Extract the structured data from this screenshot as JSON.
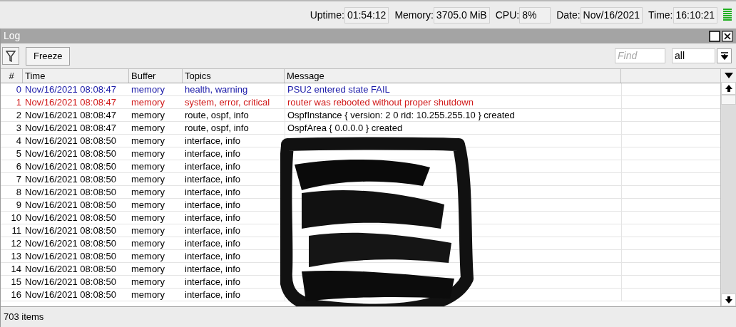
{
  "status": [
    {
      "label": "Uptime:",
      "value": "01:54:12"
    },
    {
      "label": "Memory:",
      "value": "3705.0 MiB"
    },
    {
      "label": "CPU:",
      "value": "8%"
    },
    {
      "label": "Date:",
      "value": "Nov/16/2021"
    },
    {
      "label": "Time:",
      "value": "16:10:21"
    }
  ],
  "window": {
    "title": "Log"
  },
  "toolbar": {
    "freeze": "Freeze",
    "find_placeholder": "Find",
    "filter_value": "all"
  },
  "table": {
    "columns": [
      "#",
      "Time",
      "Buffer",
      "Topics",
      "Message"
    ],
    "rows": [
      {
        "num": "0",
        "time": "Nov/16/2021 08:08:47",
        "buffer": "memory",
        "topics": "health, warning",
        "message": "PSU2 entered state FAIL",
        "kind": "warning"
      },
      {
        "num": "1",
        "time": "Nov/16/2021 08:08:47",
        "buffer": "memory",
        "topics": "system, error, critical",
        "message": "router was rebooted without proper shutdown",
        "kind": "critical"
      },
      {
        "num": "2",
        "time": "Nov/16/2021 08:08:47",
        "buffer": "memory",
        "topics": "route, ospf, info",
        "message": "OspfInstance { version: 2 0 rid: 10.255.255.10 } created",
        "kind": "info"
      },
      {
        "num": "3",
        "time": "Nov/16/2021 08:08:47",
        "buffer": "memory",
        "topics": "route, ospf, info",
        "message": "OspfArea { 0.0.0.0 } created",
        "kind": "info"
      },
      {
        "num": "4",
        "time": "Nov/16/2021 08:08:50",
        "buffer": "memory",
        "topics": "interface, info",
        "kind": "info"
      },
      {
        "num": "5",
        "time": "Nov/16/2021 08:08:50",
        "buffer": "memory",
        "topics": "interface, info",
        "kind": "info"
      },
      {
        "num": "6",
        "time": "Nov/16/2021 08:08:50",
        "buffer": "memory",
        "topics": "interface, info",
        "kind": "info"
      },
      {
        "num": "7",
        "time": "Nov/16/2021 08:08:50",
        "buffer": "memory",
        "topics": "interface, info",
        "kind": "info"
      },
      {
        "num": "8",
        "time": "Nov/16/2021 08:08:50",
        "buffer": "memory",
        "topics": "interface, info",
        "kind": "info"
      },
      {
        "num": "9",
        "time": "Nov/16/2021 08:08:50",
        "buffer": "memory",
        "topics": "interface, info",
        "kind": "info"
      },
      {
        "num": "10",
        "time": "Nov/16/2021 08:08:50",
        "buffer": "memory",
        "topics": "interface, info",
        "kind": "info"
      },
      {
        "num": "11",
        "time": "Nov/16/2021 08:08:50",
        "buffer": "memory",
        "topics": "interface, info",
        "kind": "info"
      },
      {
        "num": "12",
        "time": "Nov/16/2021 08:08:50",
        "buffer": "memory",
        "topics": "interface, info",
        "kind": "info"
      },
      {
        "num": "13",
        "time": "Nov/16/2021 08:08:50",
        "buffer": "memory",
        "topics": "interface, info",
        "kind": "info"
      },
      {
        "num": "14",
        "time": "Nov/16/2021 08:08:50",
        "buffer": "memory",
        "topics": "interface, info",
        "kind": "info"
      },
      {
        "num": "15",
        "time": "Nov/16/2021 08:08:50",
        "buffer": "memory",
        "topics": "interface, info",
        "kind": "info"
      },
      {
        "num": "16",
        "time": "Nov/16/2021 08:08:50",
        "buffer": "memory",
        "topics": "interface, info",
        "kind": "info"
      }
    ]
  },
  "status_bar": "703 items"
}
